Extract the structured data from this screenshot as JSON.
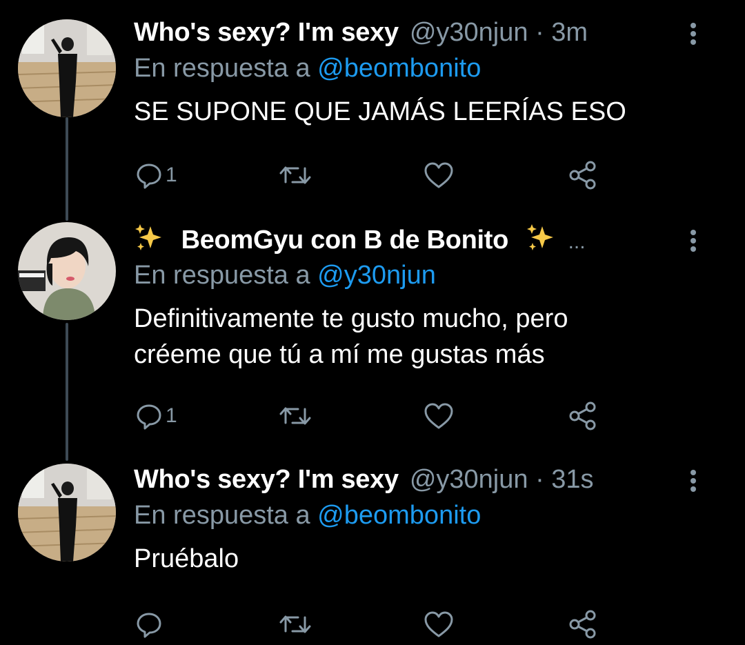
{
  "colors": {
    "background": "#000000",
    "text_primary": "#ffffff",
    "text_secondary": "#8899a6",
    "link": "#1d9bf0",
    "thread_line": "#3d4a55"
  },
  "icons": {
    "reply": "reply-icon",
    "retweet": "retweet-icon",
    "like": "heart-icon",
    "share": "share-icon",
    "more": "more-vertical-icon",
    "sparkles": "sparkles-icon"
  },
  "tweets": [
    {
      "display_name": "Who's sexy? I'm sexy",
      "handle": "@y30njun",
      "separator": "·",
      "time": "3m",
      "reply_prefix": "En respuesta a",
      "reply_to": "@beombonito",
      "text": "SE SUPONE QUE JAMÁS LEERÍAS ESO",
      "reply_count": "1"
    },
    {
      "display_name": "BeomGyu con B de Bonito",
      "name_truncation": "...",
      "reply_prefix": "En respuesta a",
      "reply_to": "@y30njun",
      "text": "Definitivamente te gusto mucho, pero créeme que tú a mí me gustas más",
      "reply_count": "1"
    },
    {
      "display_name": "Who's sexy? I'm sexy",
      "handle": "@y30njun",
      "separator": "·",
      "time": "31s",
      "reply_prefix": "En respuesta a",
      "reply_to": "@beombonito",
      "text": "Pruébalo",
      "reply_count": ""
    }
  ]
}
